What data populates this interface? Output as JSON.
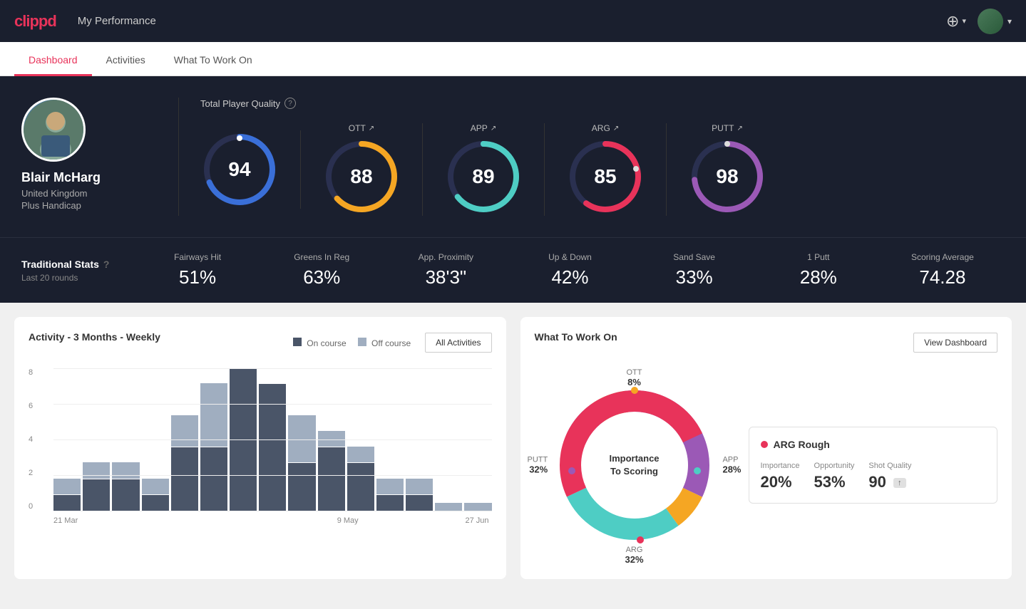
{
  "header": {
    "logo": "clippd",
    "title": "My Performance",
    "add_icon": "⊕",
    "dropdown_icon": "▾"
  },
  "tabs": [
    {
      "id": "dashboard",
      "label": "Dashboard",
      "active": true
    },
    {
      "id": "activities",
      "label": "Activities",
      "active": false
    },
    {
      "id": "what-to-work-on",
      "label": "What To Work On",
      "active": false
    }
  ],
  "player": {
    "name": "Blair McHarg",
    "country": "United Kingdom",
    "handicap": "Plus Handicap"
  },
  "quality": {
    "label": "Total Player Quality",
    "main_score": 94,
    "metrics": [
      {
        "id": "ott",
        "label": "OTT",
        "value": 88,
        "color": "#f5a623",
        "bg": "#1a1f2e"
      },
      {
        "id": "app",
        "label": "APP",
        "value": 89,
        "color": "#4ecdc4",
        "bg": "#1a1f2e"
      },
      {
        "id": "arg",
        "label": "ARG",
        "value": 85,
        "color": "#e8335a",
        "bg": "#1a1f2e"
      },
      {
        "id": "putt",
        "label": "PUTT",
        "value": 98,
        "color": "#9b59b6",
        "bg": "#1a1f2e"
      }
    ]
  },
  "traditional_stats": {
    "title": "Traditional Stats",
    "subtitle": "Last 20 rounds",
    "items": [
      {
        "label": "Fairways Hit",
        "value": "51%"
      },
      {
        "label": "Greens In Reg",
        "value": "63%"
      },
      {
        "label": "App. Proximity",
        "value": "38'3\""
      },
      {
        "label": "Up & Down",
        "value": "42%"
      },
      {
        "label": "Sand Save",
        "value": "33%"
      },
      {
        "label": "1 Putt",
        "value": "28%"
      },
      {
        "label": "Scoring Average",
        "value": "74.28"
      }
    ]
  },
  "activity_chart": {
    "title": "Activity - 3 Months - Weekly",
    "legend": {
      "on_course": "On course",
      "off_course": "Off course"
    },
    "all_activities_btn": "All Activities",
    "x_labels": [
      "21 Mar",
      "9 May",
      "27 Jun"
    ],
    "y_labels": [
      "8",
      "6",
      "4",
      "2",
      "0"
    ],
    "bars": [
      {
        "on": 1,
        "off": 1
      },
      {
        "on": 2,
        "off": 1
      },
      {
        "on": 2,
        "off": 1
      },
      {
        "on": 1,
        "off": 1
      },
      {
        "on": 4,
        "off": 2
      },
      {
        "on": 4,
        "off": 4
      },
      {
        "on": 9,
        "off": 0
      },
      {
        "on": 8,
        "off": 0
      },
      {
        "on": 3,
        "off": 3
      },
      {
        "on": 4,
        "off": 1
      },
      {
        "on": 3,
        "off": 1
      },
      {
        "on": 1,
        "off": 1
      },
      {
        "on": 1,
        "off": 1
      },
      {
        "on": 0,
        "off": 0.5
      },
      {
        "on": 0,
        "off": 0.5
      }
    ]
  },
  "what_to_work_on": {
    "title": "What To Work On",
    "view_dashboard_btn": "View Dashboard",
    "donut_center": "Importance\nTo Scoring",
    "segments": [
      {
        "label": "OTT",
        "pct": "8%",
        "color": "#f5a623",
        "position": "top"
      },
      {
        "label": "APP",
        "pct": "28%",
        "color": "#4ecdc4",
        "position": "right"
      },
      {
        "label": "ARG",
        "pct": "32%",
        "color": "#e8335a",
        "position": "bottom"
      },
      {
        "label": "PUTT",
        "pct": "32%",
        "color": "#9b59b6",
        "position": "left"
      }
    ],
    "info_card": {
      "title": "ARG Rough",
      "dot_color": "#e8335a",
      "metrics": [
        {
          "label": "Importance",
          "value": "20%"
        },
        {
          "label": "Opportunity",
          "value": "53%"
        },
        {
          "label": "Shot Quality",
          "value": "90",
          "badge": ""
        }
      ]
    }
  }
}
